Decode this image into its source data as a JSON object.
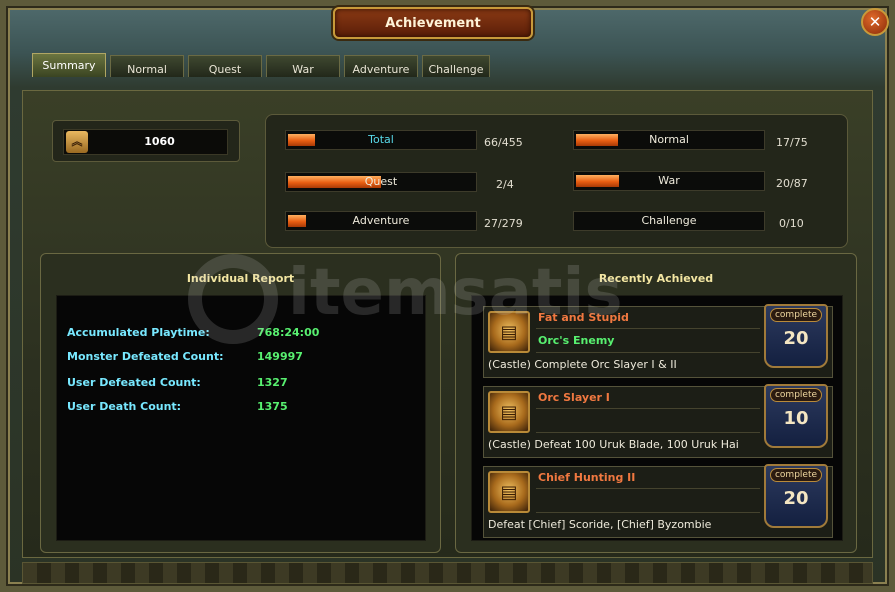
{
  "window": {
    "title": "Achievement",
    "close_symbol": "✕"
  },
  "tabs": [
    {
      "label": "Summary",
      "active": true
    },
    {
      "label": "Normal"
    },
    {
      "label": "Quest"
    },
    {
      "label": "War"
    },
    {
      "label": "Adventure"
    },
    {
      "label": "Challenge"
    }
  ],
  "points": {
    "value": "1060",
    "icon": "chevron-rank-icon"
  },
  "stats": [
    {
      "label": "Total",
      "count": "66/455",
      "fraction": 0.145
    },
    {
      "label": "Normal",
      "count": "17/75",
      "fraction": 0.227
    },
    {
      "label": "Quest",
      "count": "2/4",
      "fraction": 0.5
    },
    {
      "label": "War",
      "count": "20/87",
      "fraction": 0.23
    },
    {
      "label": "Adventure",
      "count": "27/279",
      "fraction": 0.097
    },
    {
      "label": "Challenge",
      "count": "0/10",
      "fraction": 0
    }
  ],
  "report": {
    "title": "Individual Report",
    "rows": [
      {
        "label": "Accumulated Playtime:",
        "value": "768:24:00"
      },
      {
        "label": "Monster Defeated Count:",
        "value": "149997"
      },
      {
        "label": "User Defeated Count:",
        "value": "1327"
      },
      {
        "label": "User Death Count:",
        "value": "1375"
      }
    ]
  },
  "recent": {
    "title": "Recently Achieved",
    "items": [
      {
        "name": "Fat and Stupid",
        "reward": "Orc's Enemy",
        "desc": "(Castle) Complete Orc Slayer I & II",
        "badge_label": "complete",
        "points": "20"
      },
      {
        "name": "Orc Slayer I",
        "reward": "",
        "desc": "(Castle) Defeat 100 Uruk Blade, 100 Uruk Hai",
        "badge_label": "complete",
        "points": "10"
      },
      {
        "name": "Chief Hunting II",
        "reward": "",
        "desc": "Defeat [Chief] Scoride, [Chief] Byzombie",
        "badge_label": "complete",
        "points": "20"
      }
    ]
  },
  "watermark": {
    "text": "itemsatis"
  },
  "colors": {
    "bar_fill": "#e85e12",
    "label_cyan": "#58d8e8",
    "value_green": "#58f070",
    "name_orange": "#f07840"
  }
}
